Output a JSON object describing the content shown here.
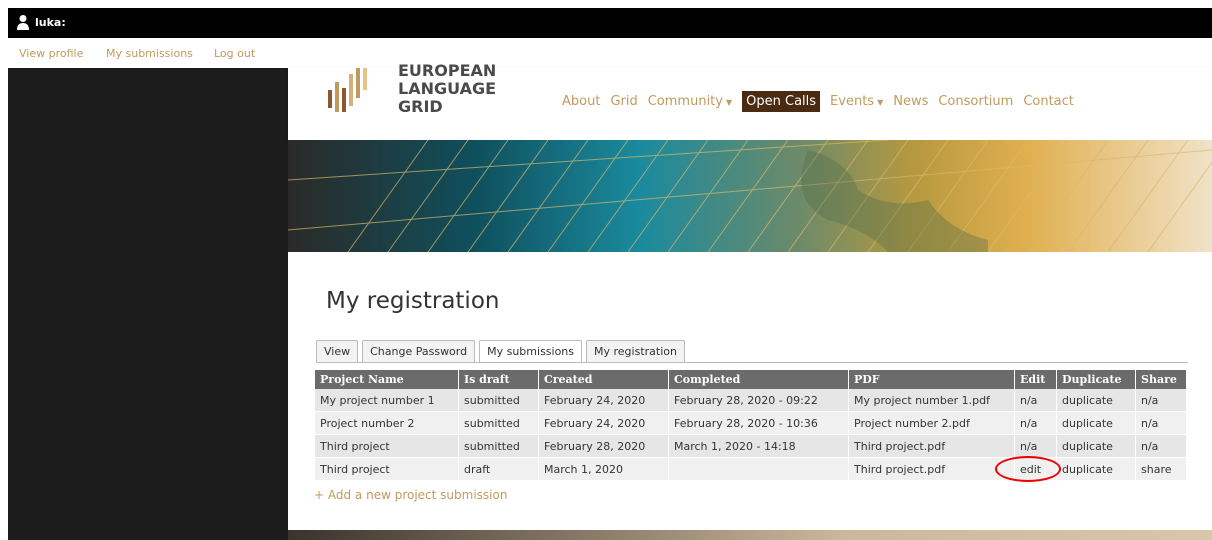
{
  "topbar": {
    "username": "luka:"
  },
  "subnav": {
    "view_profile": "View profile",
    "my_submissions": "My submissions",
    "log_out": "Log out"
  },
  "logo": {
    "line1": "EUROPEAN",
    "line2": "LANGUAGE",
    "line3": "GRID"
  },
  "mainnav": {
    "items": [
      "About",
      "Grid",
      "Community",
      "Open Calls",
      "Events",
      "News",
      "Consortium",
      "Contact"
    ],
    "active": "Open Calls"
  },
  "page": {
    "title": "My registration"
  },
  "tabs": [
    "View",
    "Change Password",
    "My submissions",
    "My registration"
  ],
  "table": {
    "headers": [
      "Project Name",
      "Is draft",
      "Created",
      "Completed",
      "PDF",
      "Edit",
      "Duplicate",
      "Share"
    ],
    "rows": [
      [
        "My project number 1",
        "submitted",
        "February 24, 2020",
        "February 28, 2020 - 09:22",
        "My project number 1.pdf",
        "n/a",
        "duplicate",
        "n/a"
      ],
      [
        "Project number 2",
        "submitted",
        "February 24, 2020",
        "February 28, 2020 - 10:36",
        "Project number 2.pdf",
        "n/a",
        "duplicate",
        "n/a"
      ],
      [
        "Third project",
        "submitted",
        "February 28, 2020",
        "March 1, 2020 - 14:18",
        "Third project.pdf",
        "n/a",
        "duplicate",
        "n/a"
      ],
      [
        "Third project",
        "draft",
        "March 1, 2020",
        "",
        "Third project.pdf",
        "edit",
        "duplicate",
        "share"
      ]
    ]
  },
  "add_link": "+ Add a new project submission",
  "colors": {
    "accent": "#c19a5e",
    "active_nav": "#4a2a10",
    "header_row": "#6b6b6b",
    "highlight_circle": "#e00000"
  }
}
